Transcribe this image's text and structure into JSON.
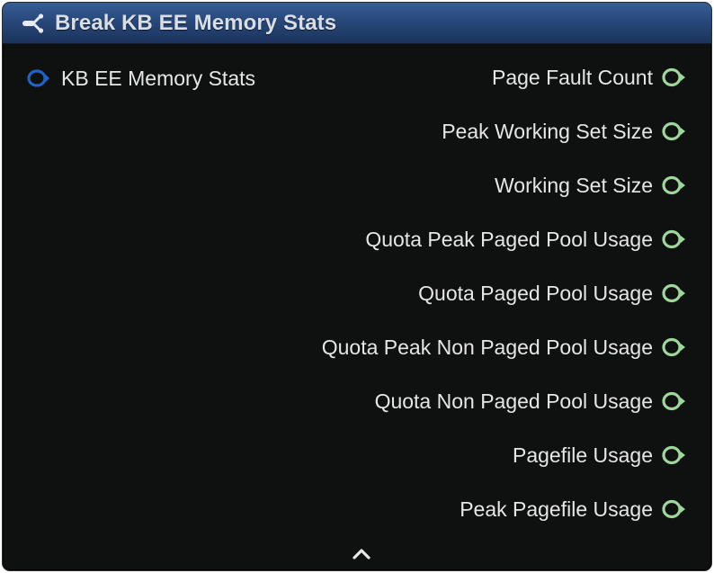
{
  "node": {
    "title": "Break KB EE Memory Stats",
    "header_color": "#28487a",
    "icon": "break-struct-icon",
    "input_pin": {
      "label": "KB EE Memory Stats",
      "color": "#1f63c4",
      "icon": "struct-pin-icon"
    },
    "output_pin_color": "#9ed79e",
    "outputs": [
      {
        "label": "Page Fault Count"
      },
      {
        "label": "Peak Working Set Size"
      },
      {
        "label": "Working Set Size"
      },
      {
        "label": "Quota Peak Paged Pool Usage"
      },
      {
        "label": "Quota Paged Pool Usage"
      },
      {
        "label": "Quota Peak Non Paged Pool Usage"
      },
      {
        "label": "Quota Non Paged Pool Usage"
      },
      {
        "label": "Pagefile Usage"
      },
      {
        "label": "Peak Pagefile Usage"
      }
    ],
    "collapse_icon": "chevron-up-icon"
  }
}
